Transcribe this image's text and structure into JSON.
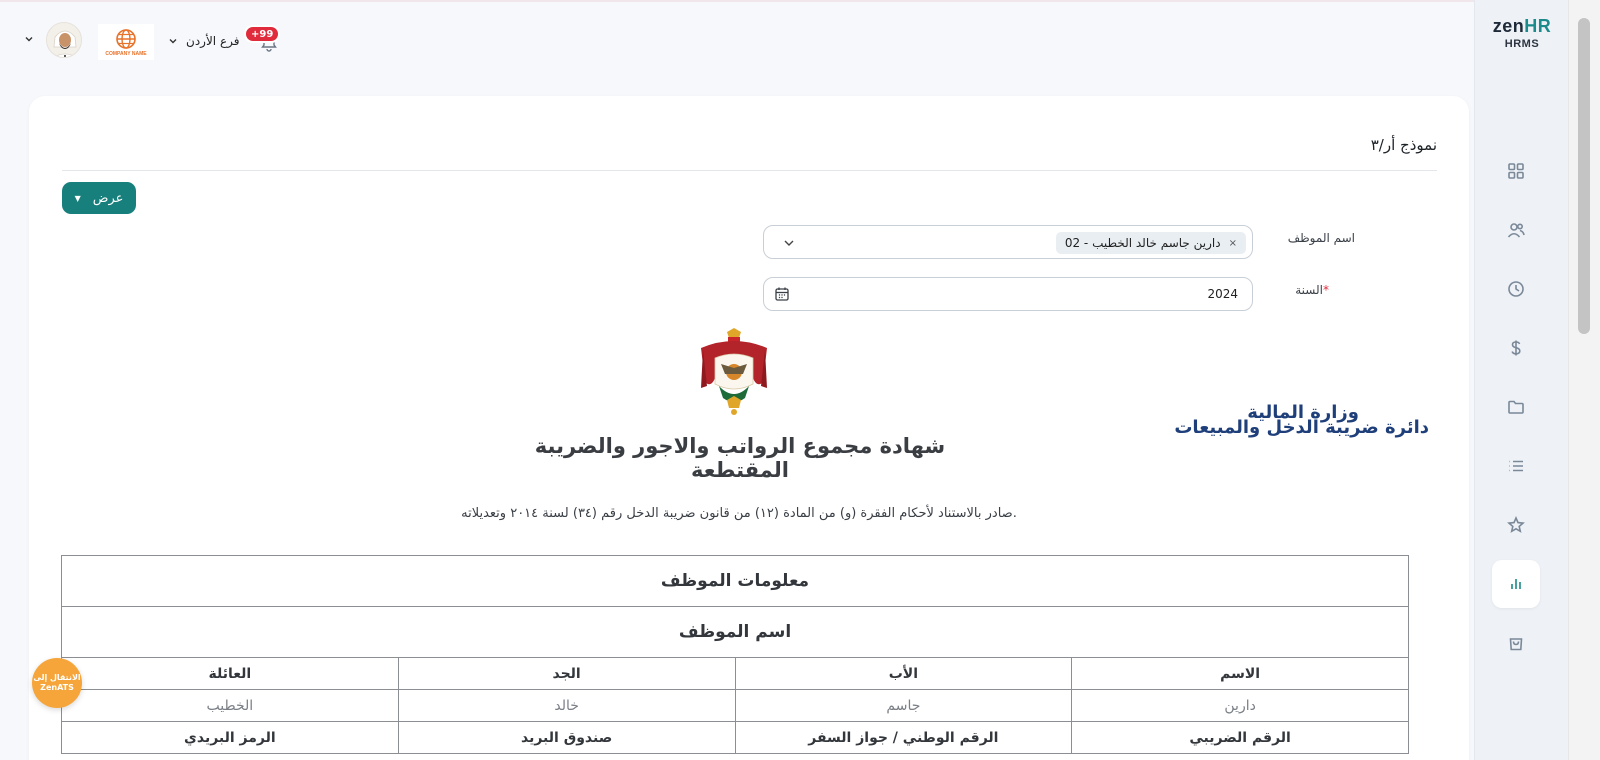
{
  "header": {
    "branch_label": "فرع الأردن",
    "notifications_badge": "+99",
    "company_logo_text": "COMPANY NAME"
  },
  "sidebar": {
    "logo_zen": "zen",
    "logo_hr": "HR",
    "logo_sub": "HRMS",
    "items": [
      {
        "icon": "dashboard-icon"
      },
      {
        "icon": "users-icon"
      },
      {
        "icon": "clock-icon"
      },
      {
        "icon": "dollar-icon"
      },
      {
        "icon": "folder-icon"
      },
      {
        "icon": "list-icon"
      },
      {
        "icon": "star-icon"
      },
      {
        "icon": "reports-icon",
        "active": true
      },
      {
        "icon": "bag-icon"
      }
    ]
  },
  "form": {
    "title": "نموذج أر/٣",
    "view_button": "عرض",
    "employee_label": "اسم الموظف",
    "employee_chip": "02 - دارين جاسم خالد الخطيب",
    "year_label": "السنة",
    "year_required_mark": "*",
    "year_value": "2024"
  },
  "certificate": {
    "ministry_line1": "وزارة المالية",
    "ministry_line2": "دائرة ضريبة الدخل والمبيعات",
    "title": "شهادة مجموع الرواتب والاجور والضريبة المقتطعة",
    "subtitle": "صادر بالاستناد لأحكام الفقرة (و) من المادة (١٢) من قانون ضريبة الدخل رقم (٣٤) لسنة ٢٠١٤ وتعديلاته.",
    "section_info": "معلومات الموظف",
    "section_name": "اسم الموظف",
    "name_headers": [
      "الاسم",
      "الأب",
      "الجد",
      "العائلة"
    ],
    "name_values": [
      "دارين",
      "جاسم",
      "خالد",
      "الخطيب"
    ],
    "id_headers": [
      "الرقم الضريبي",
      "الرقم الوطني / جواز السفر",
      "صندوق البريد",
      "الرمز البريدي"
    ]
  },
  "zenats": {
    "line1": "الانتقال إلى",
    "line2": "ZenATS"
  },
  "colors": {
    "primary": "#177f7c",
    "ministry_blue": "#1f3f7a",
    "badge_red": "#e02b3d",
    "zenats_orange": "#f5a53a"
  }
}
